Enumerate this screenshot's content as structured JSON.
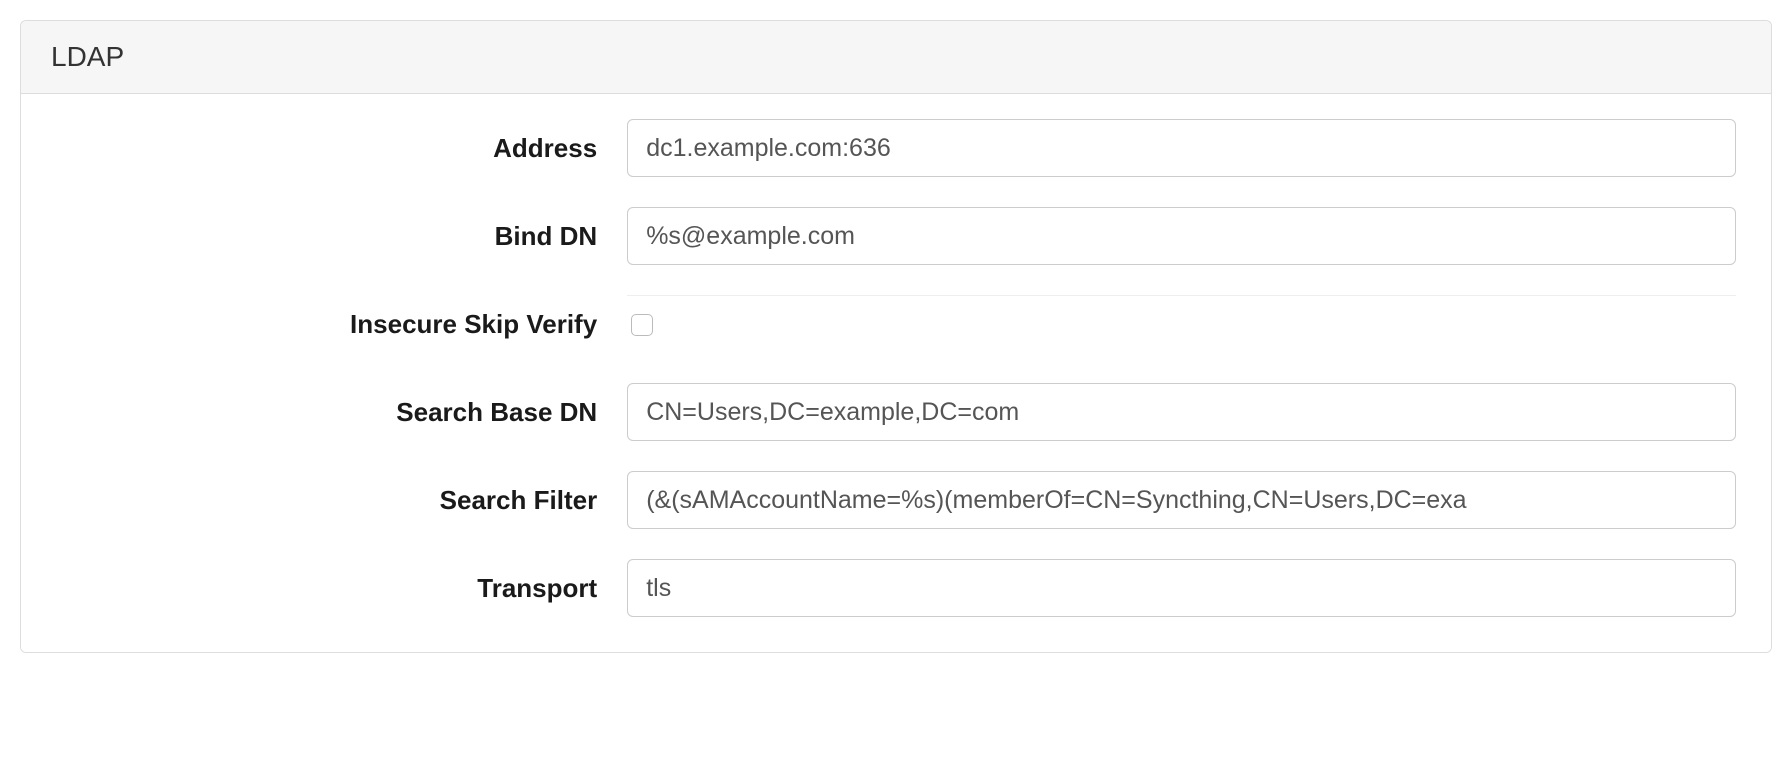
{
  "panel": {
    "title": "LDAP"
  },
  "fields": {
    "address": {
      "label": "Address",
      "value": "dc1.example.com:636"
    },
    "bind_dn": {
      "label": "Bind DN",
      "value": "%s@example.com"
    },
    "insecure_skip_verify": {
      "label": "Insecure Skip Verify",
      "checked": false
    },
    "search_base_dn": {
      "label": "Search Base DN",
      "value": "CN=Users,DC=example,DC=com"
    },
    "search_filter": {
      "label": "Search Filter",
      "value": "(&(sAMAccountName=%s)(memberOf=CN=Syncthing,CN=Users,DC=exa"
    },
    "transport": {
      "label": "Transport",
      "value": "tls"
    }
  }
}
